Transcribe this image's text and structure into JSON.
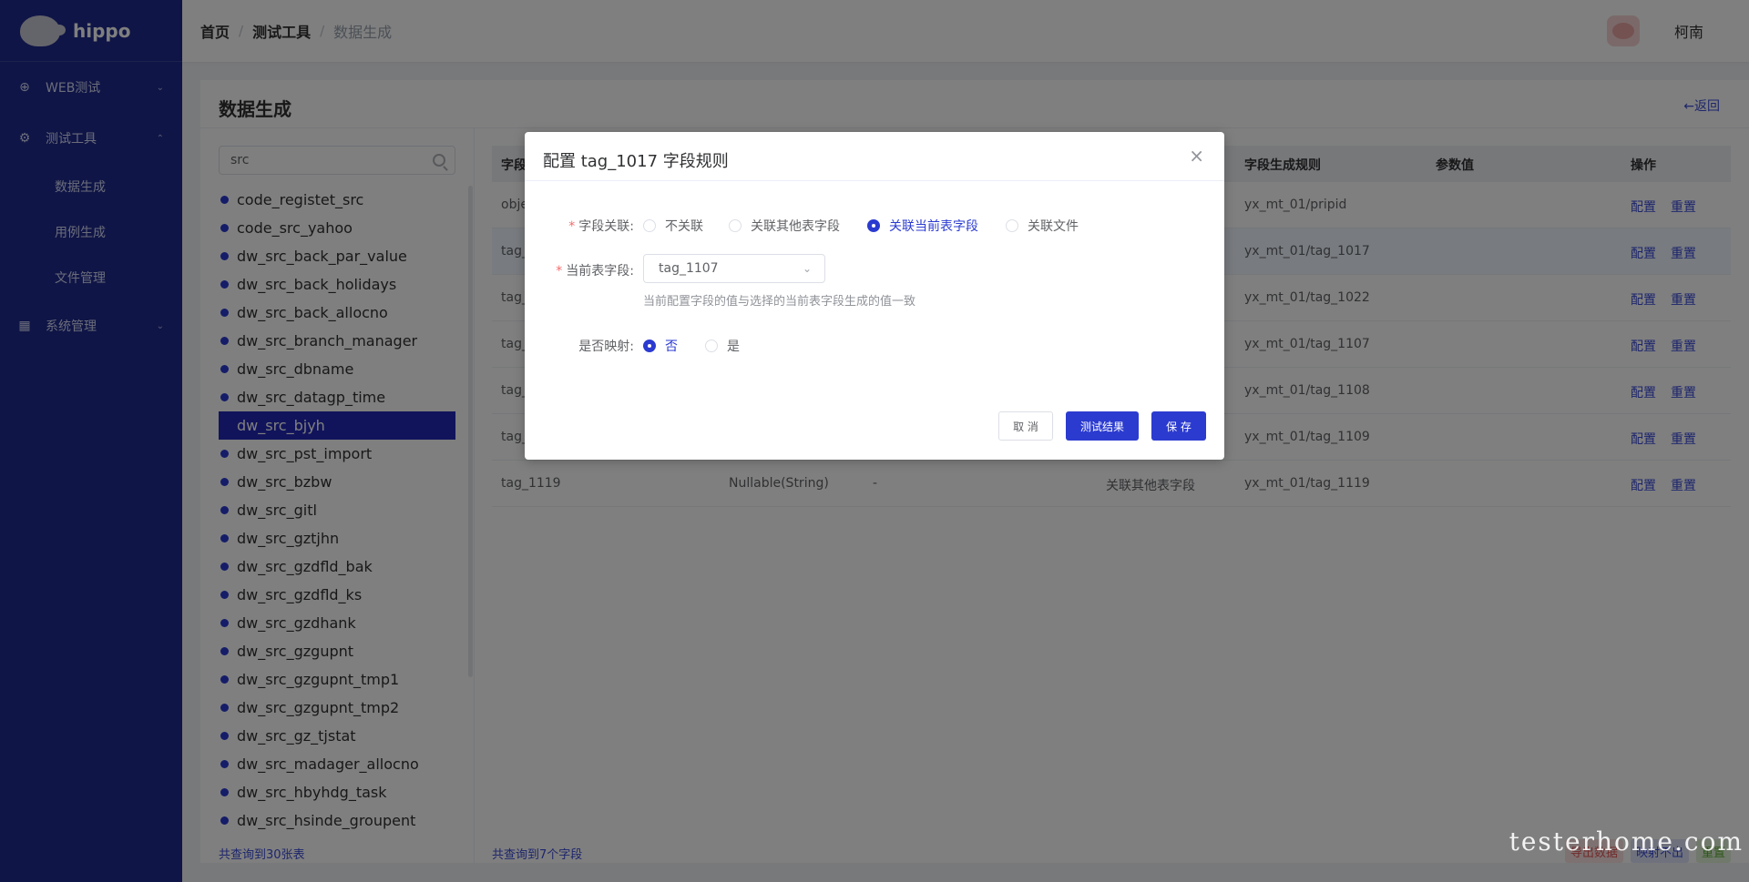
{
  "app": {
    "name": "hippo"
  },
  "sidebar": {
    "menus": [
      {
        "label": "WEB测试",
        "icon": "globe-icon",
        "expanded": false
      },
      {
        "label": "测试工具",
        "icon": "gear-icon",
        "expanded": true,
        "children": [
          "数据生成",
          "用例生成",
          "文件管理"
        ]
      },
      {
        "label": "系统管理",
        "icon": "grid-icon",
        "expanded": false
      }
    ]
  },
  "header": {
    "breadcrumbs": [
      "首页",
      "测试工具",
      "数据生成"
    ],
    "user": "柯南"
  },
  "page": {
    "title": "数据生成",
    "back": "←返回"
  },
  "left": {
    "search_value": "src",
    "tables": [
      "code_registet_src",
      "code_src_yahoo",
      "dw_src_back_par_value",
      "dw_src_back_holidays",
      "dw_src_back_allocno",
      "dw_src_branch_manager",
      "dw_src_dbname",
      "dw_src_datagp_time",
      "dw_src_bjyh",
      "dw_src_pst_import",
      "dw_src_bzbw",
      "dw_src_gitl",
      "dw_src_gztjhn",
      "dw_src_gzdfld_bak",
      "dw_src_gzdfld_ks",
      "dw_src_gzdhank",
      "dw_src_gzgupnt",
      "dw_src_gzgupnt_tmp1",
      "dw_src_gzgupnt_tmp2",
      "dw_src_gz_tjstat",
      "dw_src_madager_allocno",
      "dw_src_hbyhdg_task",
      "dw_src_hsinde_groupent"
    ],
    "active_index": 8,
    "footer": "共查询到30张表"
  },
  "table": {
    "headers": [
      "字段",
      "字段生成规则",
      "参数值",
      "操作"
    ],
    "rows": [
      {
        "c1": "obje",
        "c2": "",
        "c3": "",
        "c4": "",
        "rule": "yx_mt_01/pripid"
      },
      {
        "c1": "tag_",
        "c2": "",
        "c3": "",
        "c4": "",
        "rule": "yx_mt_01/tag_1017"
      },
      {
        "c1": "tag_",
        "c2": "",
        "c3": "",
        "c4": "",
        "rule": "yx_mt_01/tag_1022"
      },
      {
        "c1": "tag_",
        "c2": "",
        "c3": "",
        "c4": "",
        "rule": "yx_mt_01/tag_1107"
      },
      {
        "c1": "tag_",
        "c2": "",
        "c3": "",
        "c4": "",
        "rule": "yx_mt_01/tag_1108"
      },
      {
        "c1": "tag_",
        "c2": "",
        "c3": "",
        "c4": "",
        "rule": "yx_mt_01/tag_1109"
      },
      {
        "c1": "tag_1119",
        "c2": "Nullable(String)",
        "c3": "-",
        "c4": "关联其他表字段",
        "rule": "yx_mt_01/tag_1119"
      }
    ],
    "op_config": "配置",
    "op_reset": "重置",
    "footer": "共查询到7个字段",
    "footer_buttons": [
      "导出数据",
      "映射不出",
      "重置"
    ]
  },
  "dialog": {
    "title": "配置 tag_1017 字段规则",
    "relation_label": "字段关联",
    "relation_options": [
      "不关联",
      "关联其他表字段",
      "关联当前表字段",
      "关联文件"
    ],
    "relation_selected": 2,
    "current_field_label": "当前表字段",
    "current_field_value": "tag_1107",
    "hint": "当前配置字段的值与选择的当前表字段生成的值一致",
    "mapping_label": "是否映射",
    "mapping_options": [
      "否",
      "是"
    ],
    "mapping_selected": 0,
    "cancel": "取 消",
    "test": "测试结果",
    "save": "保 存"
  },
  "watermark": "testerhome.com"
}
